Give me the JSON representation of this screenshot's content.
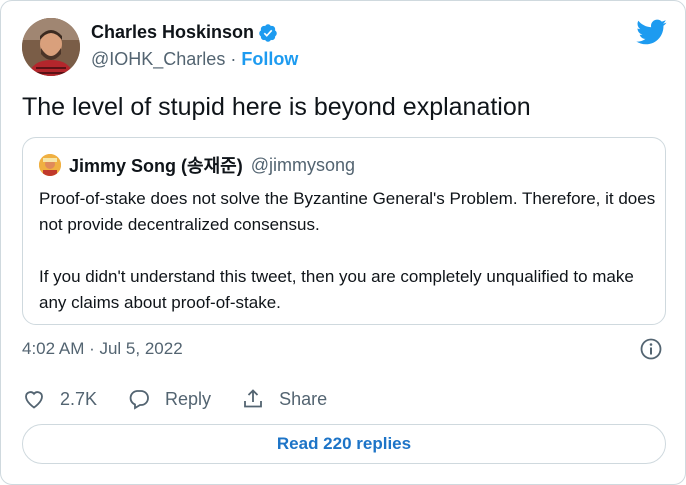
{
  "author": {
    "name": "Charles Hoskinson",
    "handle": "@IOHK_Charles",
    "separator": "·",
    "follow_label": "Follow"
  },
  "tweet": {
    "text": "The level of stupid here is beyond explanation"
  },
  "quoted": {
    "name": "Jimmy Song (송재준)",
    "handle": "@jimmysong",
    "paragraph1": "Proof-of-stake does not solve the Byzantine General's Problem. Therefore, it does not provide decentralized consensus.",
    "paragraph2": "If you didn't understand this tweet, then you are completely unqualified to make any claims about proof-of-stake."
  },
  "timestamp": "4:02 AM · Jul 5, 2022",
  "actions": {
    "like_count": "2.7K",
    "reply_label": "Reply",
    "share_label": "Share"
  },
  "read_replies_label": "Read 220 replies",
  "colors": {
    "accent": "#1d9bf0",
    "border": "#cfd9de",
    "muted": "#536471"
  }
}
